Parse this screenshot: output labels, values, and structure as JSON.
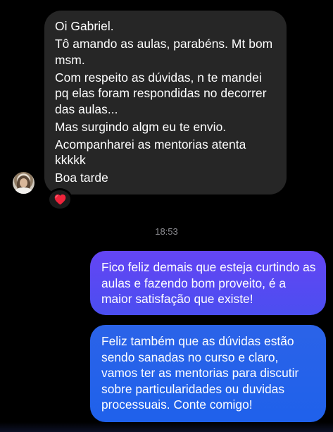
{
  "incoming_message": {
    "lines": [
      "Oi Gabriel.",
      "Tô amando as aulas, parabéns. Mt bom msm.",
      "Com respeito as dúvidas, n te mandei pq elas foram respondidas no decorrer das aulas...",
      "Mas surgindo algm eu te envio.",
      "Acompanharei as mentorias atenta kkkkk",
      "Boa tarde"
    ],
    "reaction": "❤️"
  },
  "timestamp": "18:53",
  "outgoing_messages": [
    "Fico feliz demais que esteja curtindo as aulas e fazendo bom proveito, é a maior satisfação que existe!",
    "Feliz também que as dúvidas estão sendo sanadas no curso e claro, vamos ter as mentorias para discutir sobre particularidades ou duvidas processuais. Conte comigo!"
  ],
  "colors": {
    "background": "#000000",
    "incoming_bubble": "#262626",
    "outgoing_bubble_top": "#6445f4",
    "outgoing_bubble_bottom": "#1f61eb",
    "timestamp": "#8e8e93"
  }
}
